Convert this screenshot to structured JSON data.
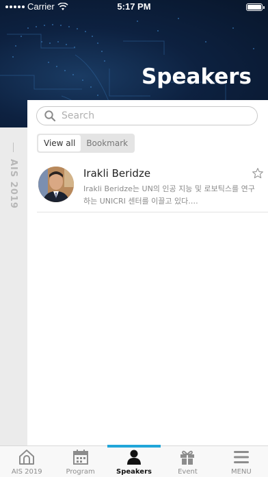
{
  "status_bar": {
    "carrier": "Carrier",
    "time": "5:17 PM"
  },
  "header": {
    "title": "Speakers"
  },
  "side_label": "AIS 2019",
  "search": {
    "placeholder": "Search",
    "value": ""
  },
  "filters": [
    {
      "label": "View all",
      "active": true
    },
    {
      "label": "Bookmark",
      "active": false
    }
  ],
  "speakers": [
    {
      "name": "Irakli Beridze",
      "description": "Irakli Beridze는 UN의 인공 지능 및 로보틱스를 연구하는 UNICRI 센터를 이끌고 있다.…",
      "bookmarked": false
    }
  ],
  "tabs": [
    {
      "label": "AIS 2019",
      "icon": "home-icon",
      "active": false
    },
    {
      "label": "Program",
      "icon": "calendar-icon",
      "active": false
    },
    {
      "label": "Speakers",
      "icon": "person-icon",
      "active": true
    },
    {
      "label": "Event",
      "icon": "gift-icon",
      "active": false
    },
    {
      "label": "MENU",
      "icon": "menu-icon",
      "active": false
    }
  ],
  "colors": {
    "accent": "#21a6d9",
    "hero_bg": "#0d2140"
  }
}
